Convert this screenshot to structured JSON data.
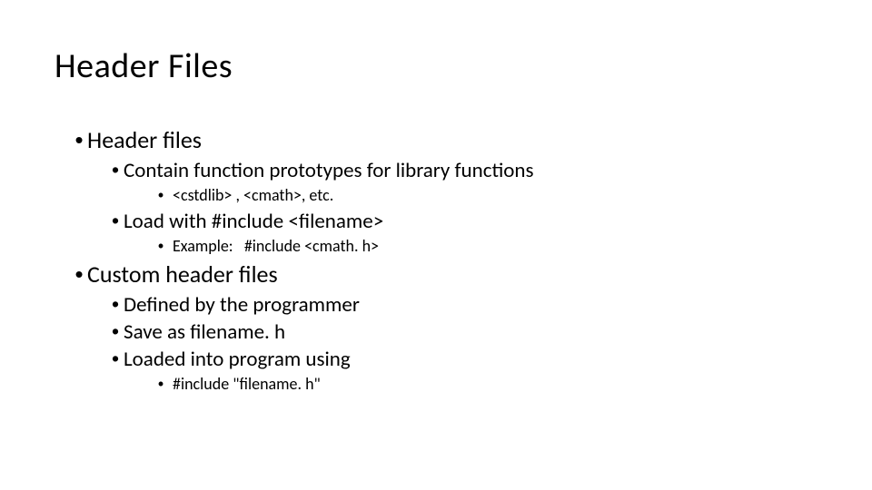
{
  "title": "Header Files",
  "items": [
    {
      "text": "Header files",
      "children": [
        {
          "text": "Contain function prototypes for library functions",
          "children": [
            {
              "text": "<cstdlib> , <cmath>, etc."
            }
          ]
        },
        {
          "text": "Load with #include <filename>",
          "children": [
            {
              "text": "Example:   #include <cmath. h>"
            }
          ]
        }
      ]
    },
    {
      "text": "Custom header files",
      "children": [
        {
          "text": "Defined by the programmer"
        },
        {
          "text": "Save as filename. h"
        },
        {
          "text": "Loaded into program using",
          "children": [
            {
              "text": "#include \"filename. h\""
            }
          ]
        }
      ]
    }
  ]
}
